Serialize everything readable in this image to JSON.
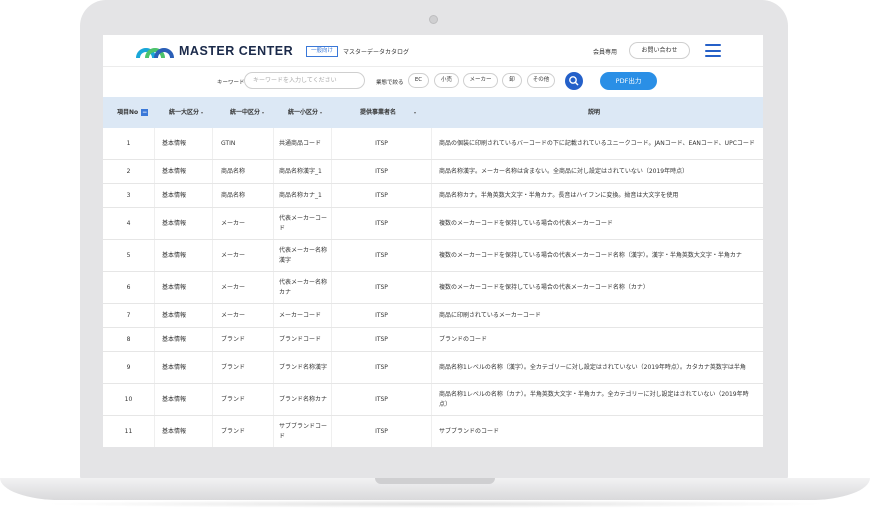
{
  "brand": {
    "name": "MASTER CENTER",
    "accent": "#2460c9",
    "logo_colors": [
      "#1aa7d8",
      "#4cc36b",
      "#2b5fb7"
    ]
  },
  "header": {
    "badge": "一般向け",
    "catalog_label": "マスターデータカタログ",
    "members_link": "会員専用",
    "contact_button": "お問い合わせ",
    "menu_icon": "hamburger-icon"
  },
  "search": {
    "keyword_label": "キーワード",
    "placeholder": "キーワードを入力してください",
    "narrow_label": "業態で絞る",
    "chips": [
      "EC",
      "小売",
      "メーカー",
      "卸",
      "その他"
    ],
    "search_icon": "search-icon",
    "pdf_button": "PDF出力"
  },
  "table": {
    "columns": [
      "項目No",
      "統一大区分",
      "統一中区分",
      "統一小区分",
      "提供事業者名",
      "説明"
    ],
    "rows": [
      [
        "1",
        "基本情報",
        "GTIN",
        "共通商品コード",
        "ITSP",
        "商品の個装に印刷されているバーコードの下に記載されているユニークコード。JANコード、EANコード、UPCコード"
      ],
      [
        "2",
        "基本情報",
        "商品名称",
        "商品名称漢字_1",
        "ITSP",
        "商品名称漢字。メーカー名称は含まない。全商品に対し設定はされていない（2019年時点）"
      ],
      [
        "3",
        "基本情報",
        "商品名称",
        "商品名称カナ_1",
        "ITSP",
        "商品名称カナ。半角英数大文字・半角カナ。長音はハイフンに変換。拗音は大文字を使用"
      ],
      [
        "4",
        "基本情報",
        "メーカー",
        "代表メーカーコード",
        "ITSP",
        "複数のメーカーコードを保持している場合の代表メーカーコード"
      ],
      [
        "5",
        "基本情報",
        "メーカー",
        "代表メーカー名称漢字",
        "ITSP",
        "複数のメーカーコードを保持している場合の代表メーカーコード名称（漢字）。漢字・半角英数大文字・半角カナ"
      ],
      [
        "6",
        "基本情報",
        "メーカー",
        "代表メーカー名称カナ",
        "ITSP",
        "複数のメーカーコードを保持している場合の代表メーカーコード名称（カナ）"
      ],
      [
        "7",
        "基本情報",
        "メーカー",
        "メーカーコード",
        "ITSP",
        "商品に印刷されているメーカーコード"
      ],
      [
        "8",
        "基本情報",
        "ブランド",
        "ブランドコード",
        "ITSP",
        "ブランドのコード"
      ],
      [
        "9",
        "基本情報",
        "ブランド",
        "ブランド名称漢字",
        "ITSP",
        "商品名称1レベルの名称（漢字）。全カテゴリーに対し設定はされていない（2019年時点）。カタカナ英数字は半角"
      ],
      [
        "10",
        "基本情報",
        "ブランド",
        "ブランド名称カナ",
        "ITSP",
        "商品名称1レベルの名称（カナ）。半角英数大文字・半角カナ。全カテゴリーに対し設定はされていない（2019年時点）"
      ],
      [
        "11",
        "基本情報",
        "ブランド",
        "サブブランドコード",
        "ITSP",
        "サブブランドのコード"
      ]
    ]
  }
}
